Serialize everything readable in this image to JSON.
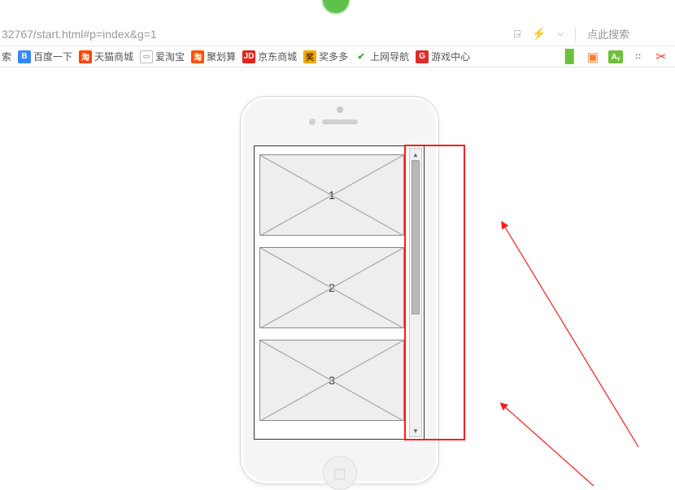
{
  "addressbar": {
    "url": "32767/start.html#p=index&g=1",
    "search_placeholder": "点此搜索"
  },
  "bookmarks": [
    {
      "icon": "logo",
      "label": "索"
    },
    {
      "icon": "baidu",
      "label": "百度一下"
    },
    {
      "icon": "tmall",
      "label": "天猫商城"
    },
    {
      "icon": "doc",
      "label": "爱淘宝"
    },
    {
      "icon": "ju",
      "label": "聚划算"
    },
    {
      "icon": "jd",
      "label": "京东商城"
    },
    {
      "icon": "jiang",
      "label": "奖多多"
    },
    {
      "icon": "hao",
      "label": "上网导航"
    },
    {
      "icon": "game",
      "label": "游戏中心"
    }
  ],
  "extensions": [
    {
      "name": "reader"
    },
    {
      "name": "tv"
    },
    {
      "name": "translate"
    },
    {
      "name": "more"
    },
    {
      "name": "snip"
    }
  ],
  "phone_screen": {
    "items": [
      {
        "label": "1"
      },
      {
        "label": "2"
      },
      {
        "label": "3"
      }
    ]
  },
  "annotation": {
    "highlight": "scrollbar"
  }
}
